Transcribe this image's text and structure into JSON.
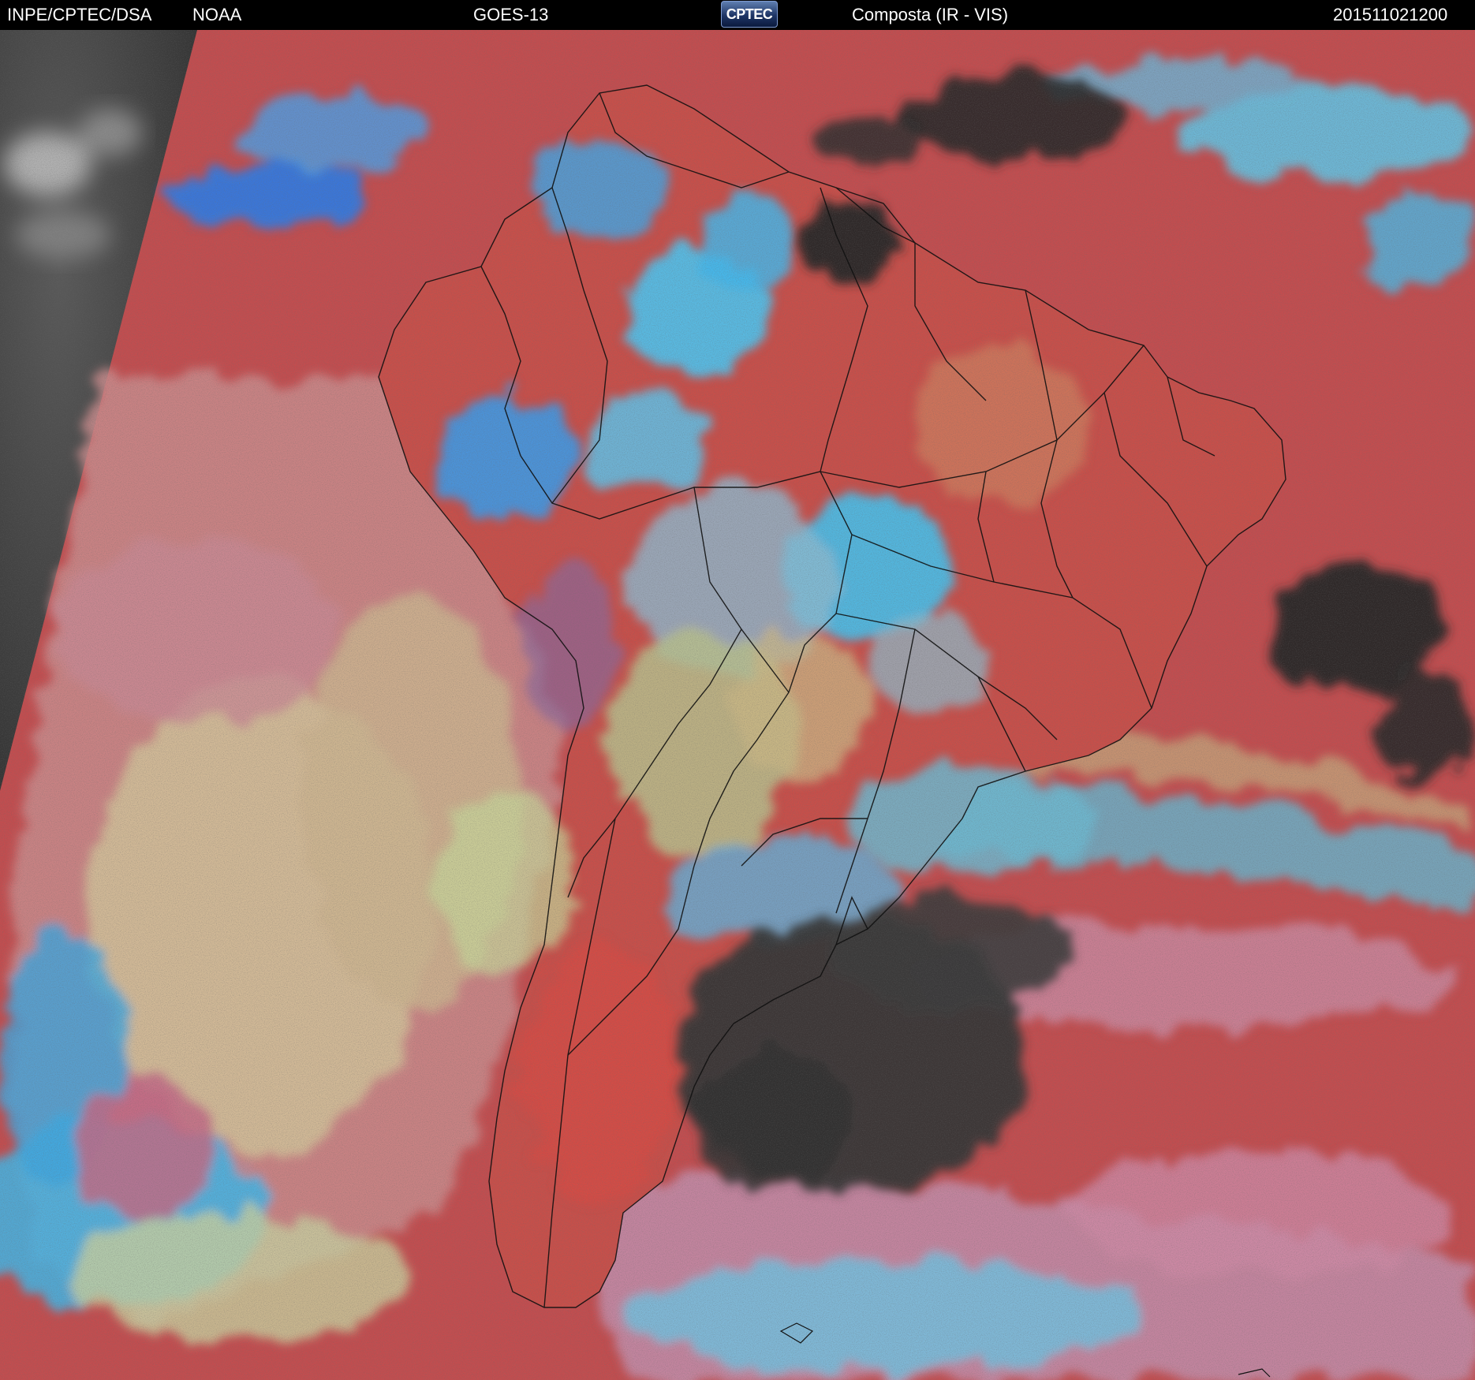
{
  "header": {
    "org": "INPE/CPTEC/DSA",
    "agency": "NOAA",
    "satellite": "GOES-13",
    "logo_text": "CPTEC",
    "product": "Composta (IR - VIS)",
    "timestamp": "201511021200"
  },
  "colors": {
    "ocean_red": "#c24d4f",
    "land_red": "#d65147",
    "cloud_cyan": "#3fb6e8",
    "cloud_blue": "#2f7ce6",
    "cloud_yellow": "#c9c28c",
    "cloud_pink": "#c8879a",
    "night_gray": "#3c3c3c",
    "clear_dark": "#262626",
    "border_line": "#111111"
  }
}
